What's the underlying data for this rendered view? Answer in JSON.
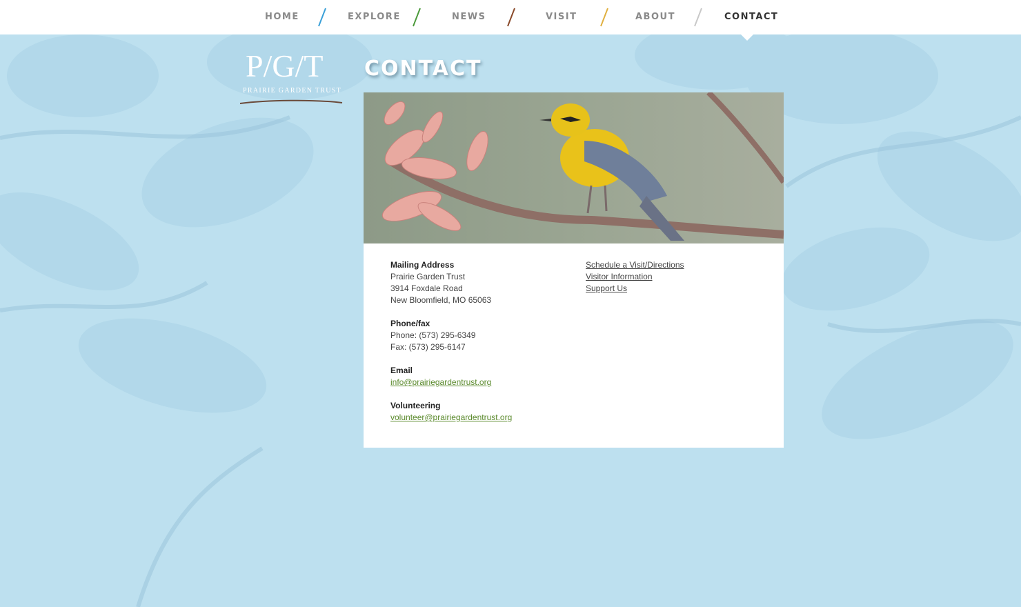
{
  "nav": {
    "items": [
      {
        "label": "HOME",
        "slash_color": "#3aa0d8"
      },
      {
        "label": "EXPLORE",
        "slash_color": "#4a9a3a"
      },
      {
        "label": "NEWS",
        "slash_color": "#8a4a2a"
      },
      {
        "label": "VISIT",
        "slash_color": "#e0b040"
      },
      {
        "label": "ABOUT",
        "slash_color": "#c8c8c8"
      },
      {
        "label": "CONTACT"
      }
    ],
    "active": "CONTACT"
  },
  "logo": {
    "letters": "P/G/T",
    "tagline": "PRAIRIE GARDEN TRUST"
  },
  "page_title": "CONTACT",
  "hero_image": "yellow-warbler-on-blossoming-branch",
  "contact": {
    "mailing": {
      "heading": "Mailing Address",
      "lines": [
        "Prairie Garden Trust",
        "3914 Foxdale Road",
        "New Bloomfield, MO 65063"
      ]
    },
    "phone": {
      "heading": "Phone/fax",
      "lines": [
        "Phone: (573) 295-6349",
        "Fax: (573) 295-6147"
      ]
    },
    "email": {
      "heading": "Email",
      "address": "info@prairiegardentrust.org"
    },
    "volunteering": {
      "heading": "Volunteering",
      "address": "volunteer@prairiegardentrust.org"
    }
  },
  "links": [
    "Schedule a Visit/Directions",
    "Visitor Information",
    "Support Us"
  ],
  "colors": {
    "background": "#bcdfee",
    "link_green": "#5b8a2d",
    "panel": "#ffffff"
  }
}
